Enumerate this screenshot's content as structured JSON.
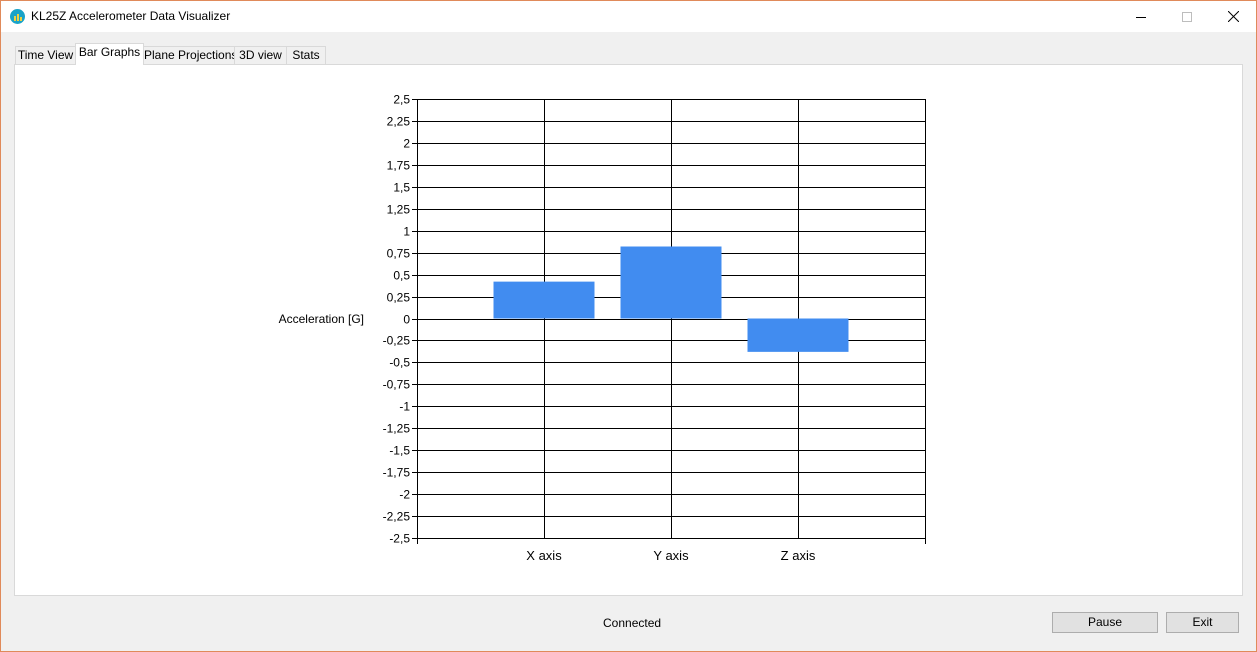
{
  "window": {
    "title": "KL25Z Accelerometer Data Visualizer",
    "controls": {
      "minimize": "minimize-icon",
      "maximize": "maximize-icon",
      "close": "close-icon"
    }
  },
  "tabs": [
    {
      "label": "Time View",
      "active": false
    },
    {
      "label": "Bar Graphs",
      "active": true
    },
    {
      "label": "Plane Projections",
      "active": false
    },
    {
      "label": "3D view",
      "active": false
    },
    {
      "label": "Stats",
      "active": false
    }
  ],
  "chart_data": {
    "type": "bar",
    "categories": [
      "X axis",
      "Y axis",
      "Z axis"
    ],
    "values": [
      0.42,
      0.82,
      -0.38
    ],
    "ylabel": "Acceleration [G]",
    "ylim": [
      -2.5,
      2.5
    ],
    "ytick_step": 0.25,
    "ytick_labels": [
      "2,5",
      "2,25",
      "2",
      "1,75",
      "1,5",
      "1,25",
      "1",
      "0,75",
      "0,5",
      "0,25",
      "0",
      "-0,25",
      "-0,5",
      "-0,75",
      "-1",
      "-1,25",
      "-1,5",
      "-1,75",
      "-2",
      "-2,25",
      "-2,5"
    ],
    "grid": true,
    "bar_color": "#418cf0"
  },
  "status": {
    "text": "Connected"
  },
  "buttons": {
    "pause": "Pause",
    "exit": "Exit"
  }
}
